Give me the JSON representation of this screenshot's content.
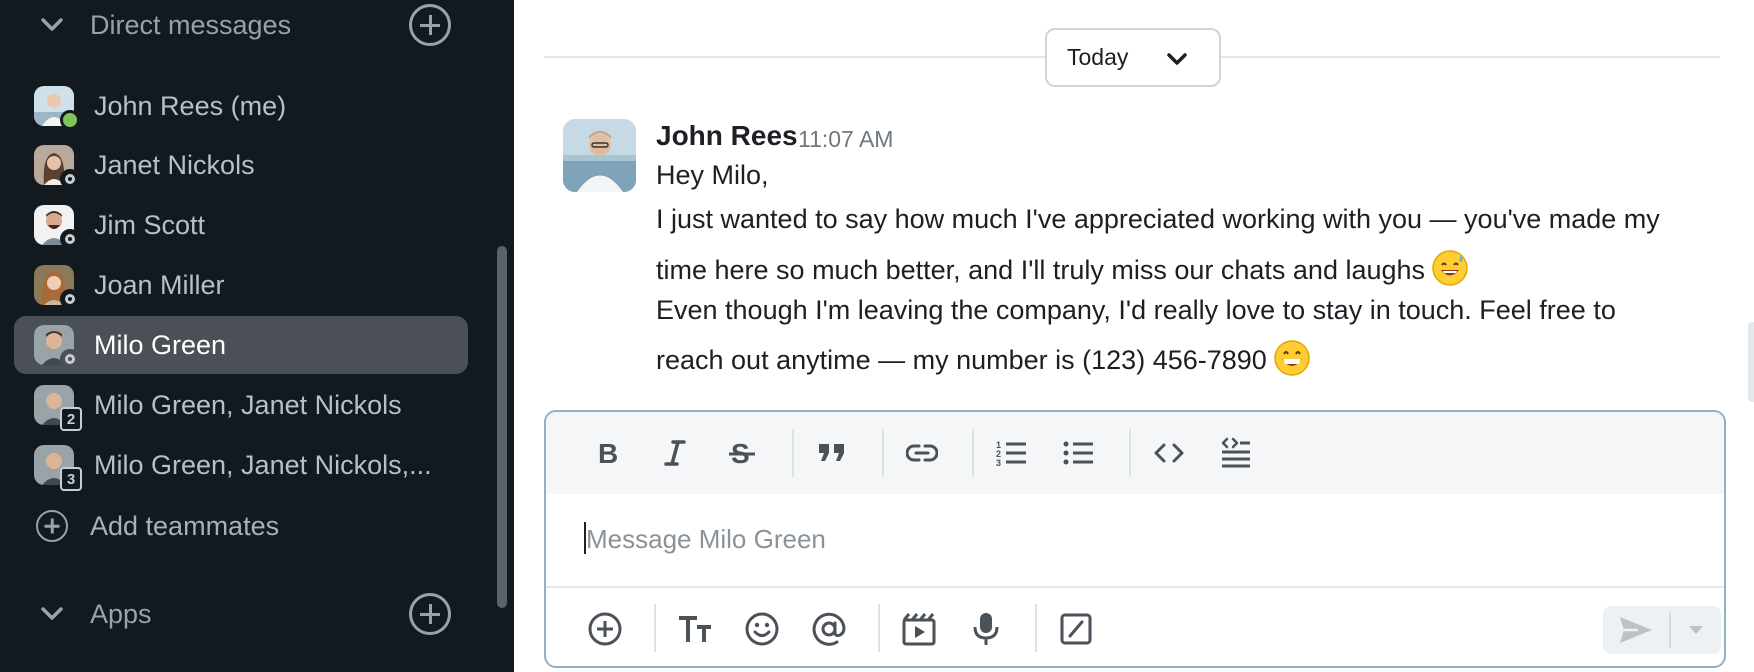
{
  "sidebar": {
    "direct_messages_title": "Direct messages",
    "apps_title": "Apps",
    "add_teammates_label": "Add teammates",
    "items": [
      {
        "label": "John Rees (me)",
        "status": "online"
      },
      {
        "label": "Janet Nickols",
        "status": "away"
      },
      {
        "label": "Jim Scott",
        "status": "away"
      },
      {
        "label": "Joan Miller",
        "status": "away"
      },
      {
        "label": "Milo Green",
        "status": "away",
        "active": true
      },
      {
        "label": "Milo Green, Janet Nickols",
        "group_count": "2"
      },
      {
        "label": "Milo Green, Janet Nickols,...",
        "group_count": "3"
      }
    ]
  },
  "main": {
    "date_separator": "Today",
    "message": {
      "author": "John Rees",
      "time": "11:07 AM",
      "lines": [
        "Hey Milo,",
        "I just wanted to say how much I've appreciated working with you — you've made my",
        "time here so much better, and I'll truly miss our chats and laughs",
        "Even though I'm leaving the company, I'd really love to stay in touch. Feel free to",
        "reach out anytime — my number is (123) 456-7890"
      ]
    },
    "composer": {
      "placeholder": "Message Milo Green",
      "value": ""
    }
  },
  "colors": {
    "sidebar_bg": "#121a20",
    "active_item_bg": "#4a5055",
    "online_status": "#7fc35a",
    "composer_border": "#8fb3c2"
  }
}
